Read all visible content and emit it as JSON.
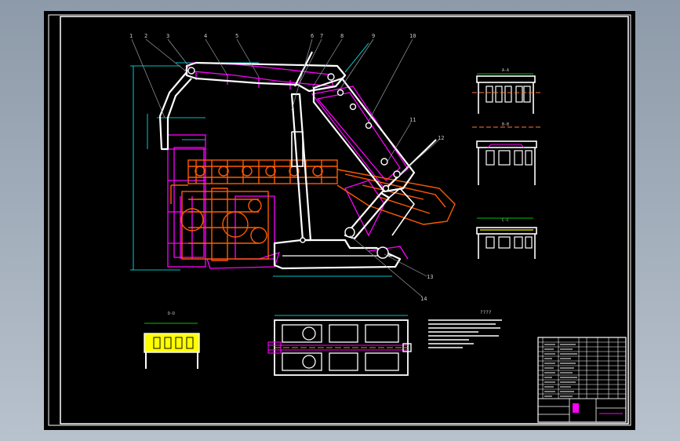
{
  "drawing": {
    "balloons": [
      "1",
      "2",
      "3",
      "4",
      "5",
      "6",
      "7",
      "8",
      "9",
      "10",
      "11",
      "12",
      "13",
      "14"
    ],
    "view_labels": {
      "section_a": "A-A",
      "section_b": "B-B",
      "section_c": "C-C",
      "section_d": "D-D"
    },
    "notes_title": "????",
    "colors": {
      "frame": "#ffffff",
      "canopy": "#ff00ff",
      "conveyor": "#ff5a00",
      "centerline": "#ff7a33",
      "highlight": "#ffff00",
      "dimension": "#00ffff"
    }
  }
}
